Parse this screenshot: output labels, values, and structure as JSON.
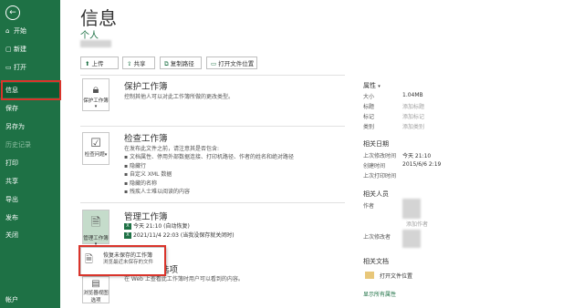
{
  "sidebar": {
    "back_icon": "←",
    "items": [
      {
        "icon": "home-icon",
        "glyph": "⌂",
        "label": "开始"
      },
      {
        "icon": "new-file-icon",
        "glyph": "▢",
        "label": "新建"
      },
      {
        "icon": "folder-open-icon",
        "glyph": "▭",
        "label": "打开"
      },
      {
        "label": "信息"
      },
      {
        "label": "保存"
      },
      {
        "label": "另存为"
      },
      {
        "label": "历史记录"
      },
      {
        "label": "打印"
      },
      {
        "label": "共享"
      },
      {
        "label": "导出"
      },
      {
        "label": "发布"
      },
      {
        "label": "关闭"
      },
      {
        "label": "帐户"
      }
    ]
  },
  "page": {
    "title": "信息",
    "doc_name": "个人"
  },
  "toolbar": {
    "upload": "上传",
    "share": "共享",
    "copy_path": "复制路径",
    "open_location": "打开文件位置"
  },
  "protect": {
    "button": "保护工作簿",
    "title": "保护工作簿",
    "desc": "控制其他人可以对此工作簿所做的更改类型。"
  },
  "inspect": {
    "button": "检查问题",
    "title": "检查工作簿",
    "desc": "在发布此文件之前，请注意其是否包含:",
    "bullets": [
      "文档属性、停用外部数据连接、打印机路径、作者的姓名和绝对路径",
      "隐藏行",
      "自定义 XML 数据",
      "隐藏的名称",
      "残疾人士难以阅读的内容"
    ]
  },
  "manage": {
    "button": "管理工作簿",
    "title": "管理工作簿",
    "versions": [
      "今天 21:10 (自动恢复)",
      "2021/11/4 22:03 (当我没保存就关闭时)"
    ]
  },
  "recover_popup": {
    "title": "恢复未保存的工作簿",
    "desc": "浏览最近未保存的文件"
  },
  "browser": {
    "button": "浏览器视图选项",
    "title_tail": "选项",
    "desc": "在 Web 上查看此工作簿时用户可以看到的内容。"
  },
  "properties": {
    "title": "属性",
    "rows": [
      {
        "label": "大小",
        "value": "1.04MB"
      },
      {
        "label": "标题",
        "value": "添加标题"
      },
      {
        "label": "标记",
        "value": "添加标记"
      },
      {
        "label": "类别",
        "value": "添加类别"
      }
    ]
  },
  "dates": {
    "title": "相关日期",
    "rows": [
      {
        "label": "上次修改时间",
        "value": "今天 21:10"
      },
      {
        "label": "创建时间",
        "value": "2015/6/6 2:19"
      },
      {
        "label": "上次打印时间",
        "value": ""
      }
    ]
  },
  "people": {
    "title": "相关人员",
    "author_label": "作者",
    "add_author": "添加作者",
    "last_modified_label": "上次修改者"
  },
  "docs": {
    "title": "相关文档",
    "open_location": "打开文件位置",
    "show_all": "显示所有属性"
  }
}
